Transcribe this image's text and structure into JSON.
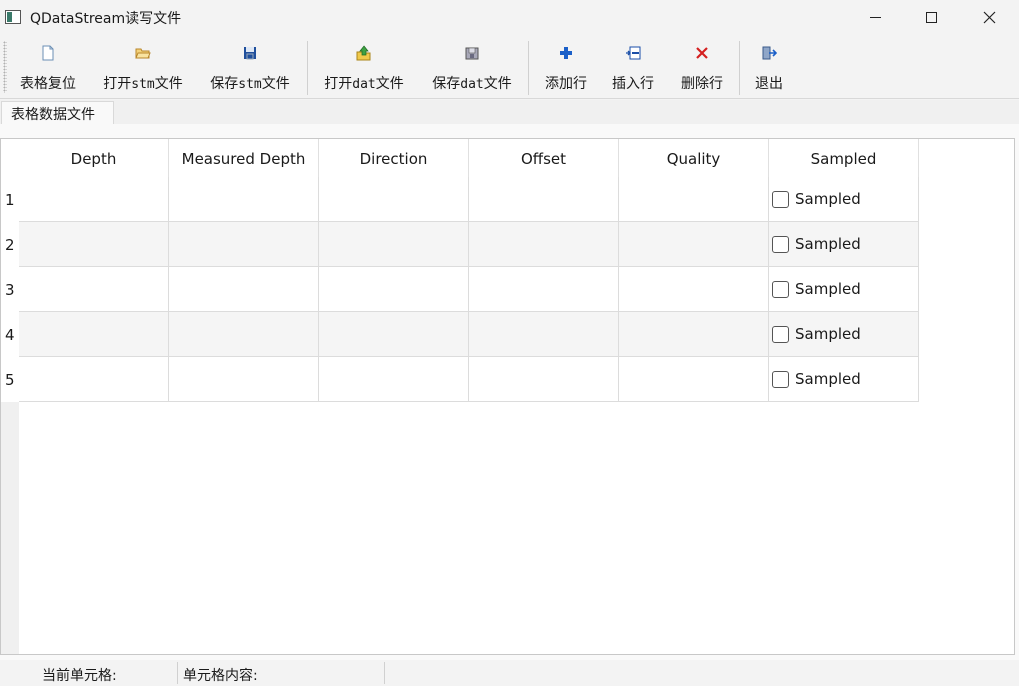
{
  "window": {
    "title": "QDataStream读写文件"
  },
  "toolbar": {
    "items": [
      {
        "label": "表格复位",
        "icon": "new-document-icon"
      },
      {
        "label_pre": "打开",
        "label_mono": "stm",
        "label_post": "文件",
        "icon": "open-folder-icon"
      },
      {
        "label_pre": "保存",
        "label_mono": "stm",
        "label_post": "文件",
        "icon": "save-disk-icon"
      },
      {
        "label_pre": "打开",
        "label_mono": "dat",
        "label_post": "文件",
        "icon": "open-upload-icon"
      },
      {
        "label_pre": "保存",
        "label_mono": "dat",
        "label_post": "文件",
        "icon": "save-archive-icon"
      },
      {
        "label": "添加行",
        "icon": "plus-icon"
      },
      {
        "label": "插入行",
        "icon": "insert-row-icon"
      },
      {
        "label": "删除行",
        "icon": "delete-x-icon"
      },
      {
        "label": "退出",
        "icon": "exit-door-icon"
      }
    ]
  },
  "tab": {
    "label": "表格数据文件"
  },
  "table": {
    "columns": [
      "Depth",
      "Measured Depth",
      "Direction",
      "Offset",
      "Quality",
      "Sampled"
    ],
    "rows": [
      {
        "num": "1",
        "check_label": "Sampled"
      },
      {
        "num": "2",
        "check_label": "Sampled"
      },
      {
        "num": "3",
        "check_label": "Sampled"
      },
      {
        "num": "4",
        "check_label": "Sampled"
      },
      {
        "num": "5",
        "check_label": "Sampled"
      }
    ]
  },
  "status": {
    "current_cell_label": "当前单元格:",
    "cell_content_label": "单元格内容:"
  },
  "colors": {
    "plus": "#1a5fc8",
    "delete": "#d42020",
    "folder": "#e8b84a"
  }
}
